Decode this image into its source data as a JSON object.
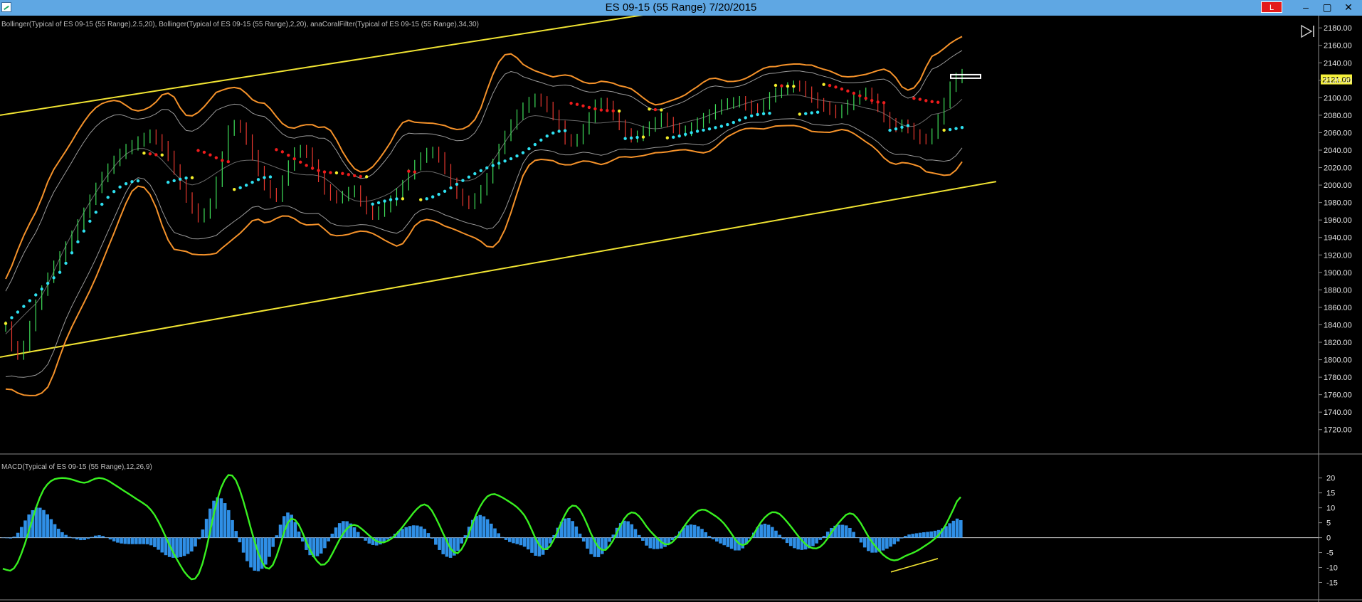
{
  "window": {
    "title": "ES 09-15 (55 Range)  7/20/2015",
    "badge": "L",
    "buttons": {
      "minimize": "–",
      "restore": "▢",
      "close": "✕"
    }
  },
  "indicators": {
    "price_panel": "Bollinger(Typical of ES 09-15 (55 Range),2.5,20), Bollinger(Typical of ES 09-15 (55 Range),2,20), anaCoralFilter(Typical of ES 09-15 (55 Range),34,30)",
    "macd_panel": "MACD(Typical of ES 09-15 (55 Range),12,26,9)"
  },
  "colors": {
    "background": "#000000",
    "titlebar": "#5fa7e3",
    "bollinger_outer": "#f5922a",
    "bollinger_inner": "#9a9a9a",
    "channel": "#f0e332",
    "coral_up": "#2ee0f0",
    "coral_down": "#ee1c1c",
    "coral_flat": "#f3ee2a",
    "macd_line": "#38f020",
    "macd_signal": "#e020e8",
    "macd_histogram": "#2f8fe6",
    "last_price_marker": "#f5f03a"
  },
  "chart_data": [
    {
      "type": "line",
      "panel": "price",
      "symbol": "ES 09-15 (55 Range)",
      "ylim": [
        1710,
        2194
      ],
      "y_ticks": [
        "2180.00",
        "2160.00",
        "2140.00",
        "2120.00",
        "2100.00",
        "2080.00",
        "2060.00",
        "2040.00",
        "2020.00",
        "2000.00",
        "1980.00",
        "1960.00",
        "1940.00",
        "1920.00",
        "1900.00",
        "1880.00",
        "1860.00",
        "1840.00",
        "1820.00",
        "1800.00",
        "1780.00",
        "1760.00",
        "1740.00",
        "1720.00"
      ],
      "last_price": "2121.00",
      "bar_count": 160,
      "price_series": [
        1838,
        1802,
        1818,
        1860,
        1886,
        1908,
        1925,
        1945,
        1966,
        1990,
        2010,
        2025,
        2038,
        2045,
        2052,
        2058,
        2048,
        2030,
        2002,
        1978,
        1962,
        1972,
        2012,
        2062,
        2072,
        2050,
        2020,
        1994,
        1986,
        2016,
        2040,
        2040,
        2018,
        1995,
        1984,
        1988,
        1996,
        1976,
        1966,
        1972,
        1984,
        1998,
        2018,
        2032,
        2040,
        2030,
        2004,
        1984,
        1978,
        1990,
        2012,
        2040,
        2064,
        2082,
        2094,
        2100,
        2090,
        2075,
        2050,
        2050,
        2068,
        2092,
        2095,
        2078,
        2060,
        2053,
        2062,
        2070,
        2078,
        2066,
        2060,
        2066,
        2075,
        2082,
        2092,
        2094,
        2096,
        2088,
        2086,
        2100,
        2108,
        2112,
        2115,
        2105,
        2094,
        2088,
        2082,
        2090,
        2100,
        2106,
        2095,
        2076,
        2066,
        2070,
        2058,
        2050,
        2060,
        2090,
        2120,
        2127
      ],
      "channel": {
        "upper": [
          [
            0,
            2080
          ],
          [
            1110,
            2221
          ]
        ],
        "lower": [
          [
            0,
            1803
          ],
          [
            1400,
            2004
          ]
        ]
      }
    },
    {
      "type": "line",
      "panel": "macd",
      "ylim": [
        -17.5,
        23.5
      ],
      "y_ticks": [
        "20",
        "15",
        "10",
        "5",
        "0",
        "-5",
        "-10",
        "-15"
      ],
      "macd_series": [
        -10,
        -12,
        -6,
        4,
        14,
        19,
        20,
        20,
        19,
        18,
        20,
        20,
        18,
        16,
        14,
        12,
        10,
        5,
        -2,
        -8,
        -13,
        -15,
        -6,
        10,
        20,
        22,
        14,
        2,
        -8,
        -12,
        -4,
        7,
        6,
        -2,
        -8,
        -10,
        -4,
        2,
        5,
        3,
        0,
        -2,
        -1,
        2,
        6,
        10,
        12,
        7,
        0,
        -6,
        -4,
        5,
        12,
        15,
        14,
        12,
        10,
        6,
        -2,
        -5,
        0,
        8,
        12,
        8,
        0,
        -5,
        -3,
        4,
        9,
        8,
        3,
        0,
        -3,
        -1,
        4,
        8,
        10,
        8,
        6,
        2,
        -3,
        -2,
        4,
        8,
        9,
        6,
        2,
        -2,
        -4,
        -3,
        2,
        6,
        9,
        6,
        0,
        -4,
        -7,
        -8,
        -6,
        -5,
        -3,
        -1,
        2,
        8,
        15
      ]
    }
  ]
}
